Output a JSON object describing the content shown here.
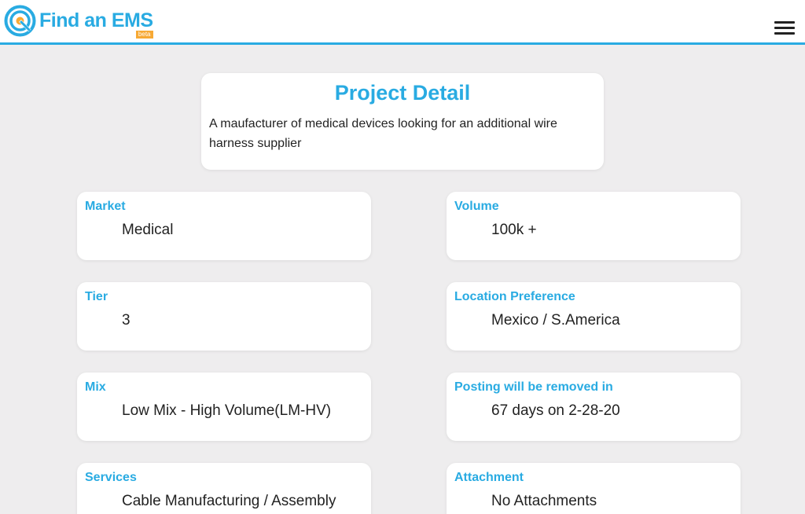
{
  "header": {
    "logo_text": "Find an EMS",
    "logo_badge": "beta",
    "menu_icon": "hamburger-menu-icon",
    "accent_color": "#29abe2"
  },
  "project": {
    "title": "Project Detail",
    "description": "A maufacturer of medical devices looking for an additional wire harness supplier"
  },
  "fields": {
    "market": {
      "label": "Market",
      "value": "Medical"
    },
    "volume": {
      "label": "Volume",
      "value": "100k +"
    },
    "tier": {
      "label": "Tier",
      "value": "3"
    },
    "location": {
      "label": "Location Preference",
      "value": "Mexico / S.America"
    },
    "mix": {
      "label": "Mix",
      "value": "Low Mix - High Volume(LM-HV)"
    },
    "posting": {
      "label": "Posting will be removed in",
      "value": "67 days on 2-28-20"
    },
    "services": {
      "label": "Services",
      "value": "Cable Manufacturing / Assembly"
    },
    "attachment": {
      "label": "Attachment",
      "value": "No Attachments"
    }
  }
}
